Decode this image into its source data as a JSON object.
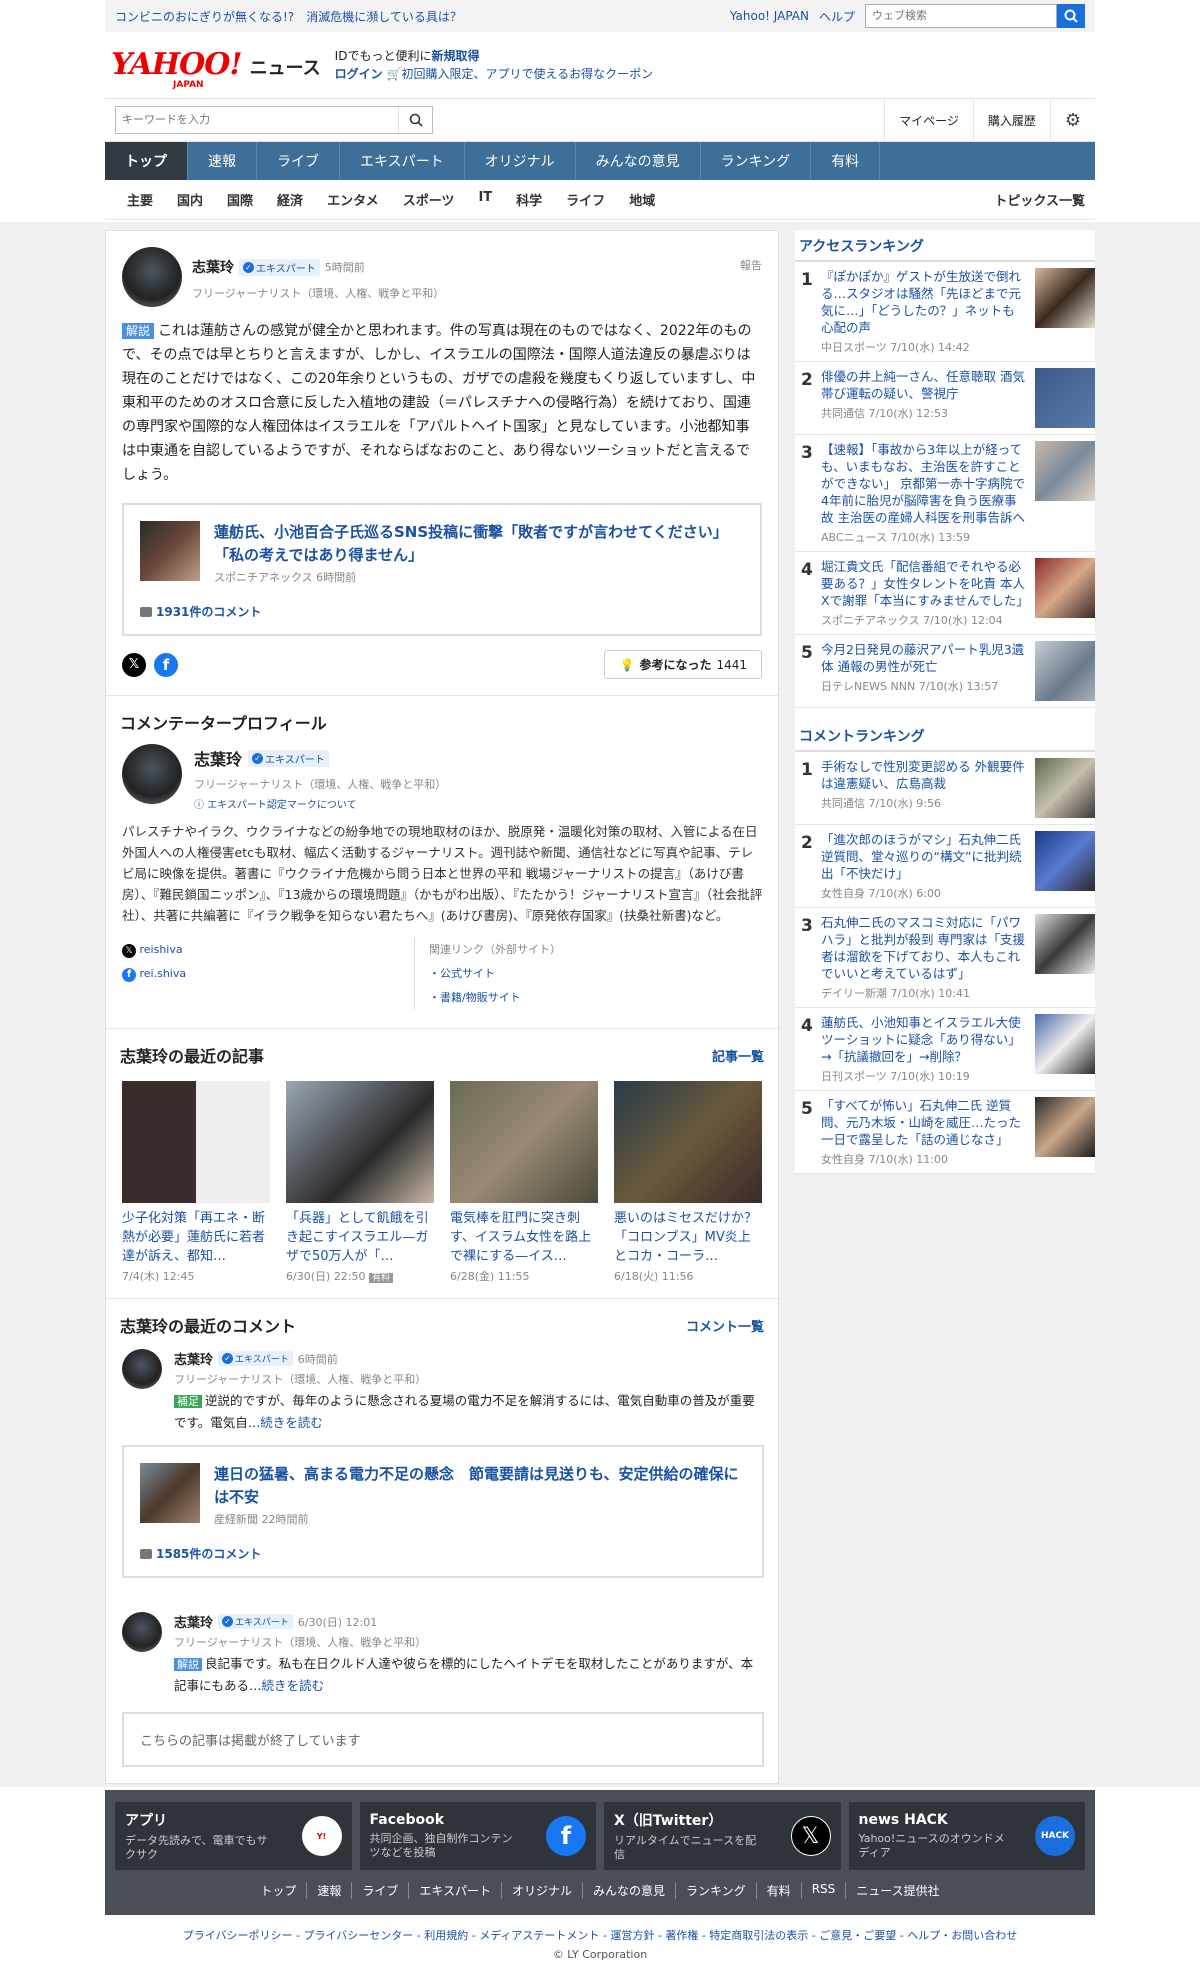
{
  "topstrip": {
    "pr1": "コンビニのおにぎりが無くなる!?",
    "pr2": "消滅危機に瀕している具は？",
    "yahoo_japan": "Yahoo! JAPAN",
    "help": "ヘルプ",
    "web_search_placeholder": "ウェブ検索"
  },
  "header": {
    "logo_text": "YAHOO!",
    "logo_sub": "JAPAN",
    "logo_news": "ニュース",
    "id_line_prefix": "IDでもっと便利に",
    "id_line_link": "新規取得",
    "login": "ログイン",
    "coupon": "初回購入限定、アプリで使えるお得なクーポン"
  },
  "search": {
    "placeholder": "キーワードを入力",
    "mypage": "マイページ",
    "history": "購入履歴"
  },
  "mainnav": [
    "トップ",
    "速報",
    "ライブ",
    "エキスパート",
    "オリジナル",
    "みんなの意見",
    "ランキング",
    "有料"
  ],
  "subnav": [
    "主要",
    "国内",
    "国際",
    "経済",
    "エンタメ",
    "スポーツ",
    "IT",
    "科学",
    "ライフ",
    "地域"
  ],
  "subnav_right": "トピックス一覧",
  "comment": {
    "author": "志葉玲",
    "badge": "エキスパート",
    "time": "5時間前",
    "report": "報告",
    "profile": "フリージャーナリスト（環境、人権、戦争と平和）",
    "tag": "解説",
    "body": "これは蓮舫さんの感覚が健全かと思われます。件の写真は現在のものではなく、2022年のもので、その点では早とちりと言えますが、しかし、イスラエルの国際法・国際人道法違反の暴虐ぶりは現在のことだけではなく、この20年余りというもの、ガザでの虐殺を幾度もくり返していますし、中東和平のためのオスロ合意に反した入植地の建設（＝パレスチナへの侵略行為）を続けており、国連の専門家や国際的な人権団体はイスラエルを「アパルトヘイト国家」と見なしています。小池都知事は中東通を自認しているようですが、それならばなおのこと、あり得ないツーショットだと言えるでしょう。",
    "link_title": "蓮舫氏、小池百合子氏巡るSNS投稿に衝撃「敗者ですが言わせてください」「私の考えではあり得ません」",
    "link_source": "スポニチアネックス",
    "link_time": "6時間前",
    "link_comments": "1931件のコメント",
    "helpful": "参考になった",
    "helpful_count": "1441"
  },
  "profile": {
    "heading": "コメンテータープロフィール",
    "name": "志葉玲",
    "badge": "エキスパート",
    "title": "フリージャーナリスト（環境、人権、戦争と平和）",
    "mark_about": "エキスパート認定マークについて",
    "bio": "パレスチナやイラク、ウクライナなどの紛争地での現地取材のほか、脱原発・温暖化対策の取材、入管による在日外国人への人権侵害etcも取材、幅広く活動するジャーナリスト。週刊誌や新聞、通信社などに写真や記事、テレビ局に映像を提供。著書に『ウクライナ危機から問う日本と世界の平和 戦場ジャーナリストの提言』（あけび書房）、『難民鎖国ニッポン』、『13歳からの環境問題』（かもがわ出版）、『たたかう！ジャーナリスト宣言』（社会批評社）、共著に共編著に『イラク戦争を知らない君たちへ』(あけび書房)、『原発依存国家』(扶桑社新書)など。",
    "x_account": "reishiva",
    "fb_account": "rei.shiva",
    "related_heading": "関連リンク（外部サイト）",
    "related1": "・公式サイト",
    "related2": "・書籍/物販サイト"
  },
  "recent_articles": {
    "heading": "志葉玲の最近の記事",
    "more": "記事一覧",
    "items": [
      {
        "title": "少子化対策「再エネ・断熱が必要」蓮舫氏に若者達が訴え、都知…",
        "date": "7/4(木) 12:45",
        "paid": ""
      },
      {
        "title": "「兵器」として飢餓を引き起こすイスラエル—ガザで50万人が「…",
        "date": "6/30(日) 22:50",
        "paid": "有料"
      },
      {
        "title": "電気棒を肛門に突き刺す、イスラム女性を路上で裸にする—イス…",
        "date": "6/28(金) 11:55",
        "paid": ""
      },
      {
        "title": "悪いのはミセスだけか？「コロンブス」MV炎上とコカ・コーラ…",
        "date": "6/18(火) 11:56",
        "paid": ""
      }
    ]
  },
  "recent_comments": {
    "heading": "志葉玲の最近のコメント",
    "more": "コメント一覧",
    "c1": {
      "name": "志葉玲",
      "badge": "エキスパート",
      "time": "6時間前",
      "title": "フリージャーナリスト（環境、人権、戦争と平和）",
      "tag": "補足",
      "text": "逆説的ですが、毎年のように懸念される夏場の電力不足を解消するには、電気自動車の普及が重要です。電気自…",
      "more": "続きを読む",
      "link_title": "連日の猛暑、高まる電力不足の懸念　節電要請は見送りも、安定供給の確保には不安",
      "link_source": "産経新聞",
      "link_time": "22時間前",
      "link_comments": "1585件のコメント"
    },
    "c2": {
      "name": "志葉玲",
      "badge": "エキスパート",
      "time": "6/30(日) 12:01",
      "title": "フリージャーナリスト（環境、人権、戦争と平和）",
      "tag": "解説",
      "text": "良記事です。私も在日クルド人達や彼らを標的にしたヘイトデモを取材したことがありますが、本記事にもある…",
      "more": "続きを読む",
      "ended": "こちらの記事は掲載が終了しています"
    }
  },
  "access_ranking": {
    "heading": "アクセスランキング",
    "items": [
      {
        "n": "1",
        "title": "『ぽかぽか』ゲストが生放送で倒れる…スタジオは騒然「先ほどまで元気に…」「どうしたの？」ネットも心配の声",
        "src": "中日スポーツ 7/10(水) 14:42"
      },
      {
        "n": "2",
        "title": "俳優の井上純一さん、任意聴取 酒気帯び運転の疑い、警視庁",
        "src": "共同通信 7/10(水) 12:53"
      },
      {
        "n": "3",
        "title": "【速報】「事故から3年以上が経っても、いまもなお、主治医を許すことができない」 京都第一赤十字病院で4年前に胎児が脳障害を負う医療事故 主治医の産婦人科医を刑事告訴へ",
        "src": "ABCニュース 7/10(水) 13:59"
      },
      {
        "n": "4",
        "title": "堀江貴文氏「配信番組でそれやる必要ある？」女性タレントを叱責 本人Xで謝罪「本当にすみませんでした」",
        "src": "スポニチアネックス 7/10(水) 12:04"
      },
      {
        "n": "5",
        "title": "今月2日発見の藤沢アパート乳児3遺体 通報の男性が死亡",
        "src": "日テレNEWS NNN 7/10(水) 13:57"
      }
    ]
  },
  "comment_ranking": {
    "heading": "コメントランキング",
    "items": [
      {
        "n": "1",
        "title": "手術なしで性別変更認める 外観要件は違憲疑い、広島高裁",
        "src": "共同通信 7/10(水) 9:56"
      },
      {
        "n": "2",
        "title": "「進次郎のほうがマシ」石丸伸二氏 逆質問、堂々巡りの“構文”に批判続出「不快だけ」",
        "src": "女性自身 7/10(水) 6:00"
      },
      {
        "n": "3",
        "title": "石丸伸二氏のマスコミ対応に「パワハラ」と批判が殺到 専門家は「支援者は溜飲を下げており、本人もこれでいいと考えているはず」",
        "src": "デイリー新潮 7/10(水) 10:41"
      },
      {
        "n": "4",
        "title": "蓮舫氏、小池知事とイスラエル大使ツーショットに疑念「あり得ない」→「抗議撤回を」→削除？",
        "src": "日刊スポーツ 7/10(水) 10:19"
      },
      {
        "n": "5",
        "title": "「すべてが怖い」石丸伸二氏 逆質問、元乃木坂・山崎を威圧…たった一日で露呈した「話の通じなさ」",
        "src": "女性自身 7/10(水) 11:00"
      }
    ]
  },
  "footer": {
    "cards": [
      {
        "title": "アプリ",
        "desc": "データ先読みで、電車でもサクサク"
      },
      {
        "title": "Facebook",
        "desc": "共同企画、独自制作コンテンツなどを投稿"
      },
      {
        "title": "X（旧Twitter）",
        "desc": "リアルタイムでニュースを配信"
      },
      {
        "title": "news HACK",
        "desc": "Yahoo!ニュースのオウンドメディア"
      }
    ],
    "links": [
      "トップ",
      "速報",
      "ライブ",
      "エキスパート",
      "オリジナル",
      "みんなの意見",
      "ランキング",
      "有料",
      "RSS",
      "ニュース提供社"
    ],
    "legal": "プライバシーポリシー - プライバシーセンター - 利用規約 - メディアステートメント - 運営方針 - 著作権 - 特定商取引法の表示 - ご意見・ご要望 - ヘルプ・お問い合わせ",
    "copyright": "© LY Corporation"
  }
}
